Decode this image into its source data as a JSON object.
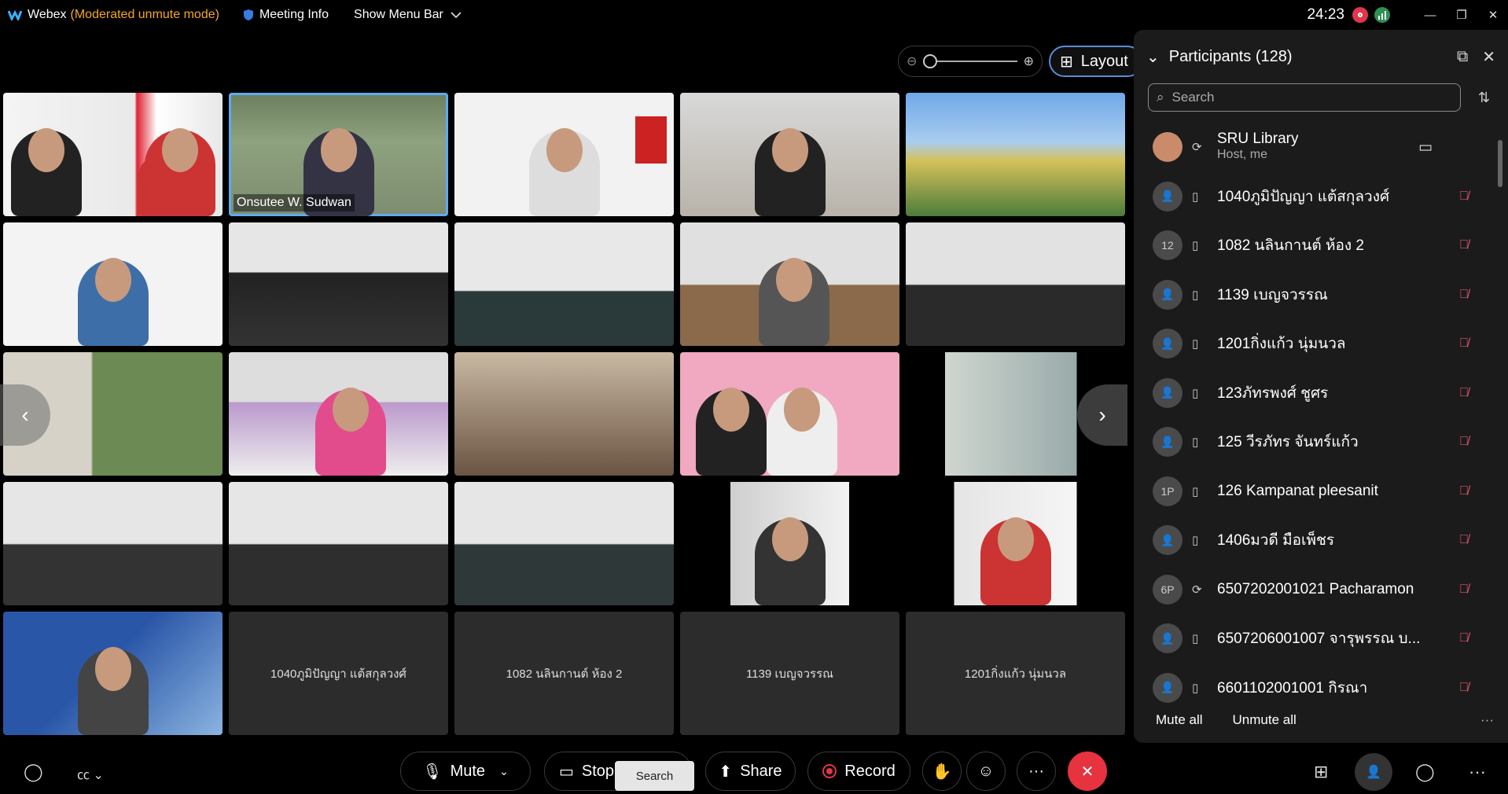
{
  "titlebar": {
    "app_name": "Webex",
    "mode": "(Moderated unmute mode)",
    "meeting_info": "Meeting Info",
    "show_menu": "Show Menu Bar",
    "clock": "24:23"
  },
  "layout_button": "Layout",
  "grid": {
    "active_name": "Onsutee W. Sudwan",
    "name_tiles": [
      "1040ภูมิปัญญา แต้สกุลวงศ์",
      "1082 นลินกานต์ ห้อง 2",
      "1139 เบญจวรรณ",
      "1201กิ่งแก้ว นุ่มนวล"
    ]
  },
  "participants": {
    "title": "Participants (128)",
    "search_placeholder": "Search",
    "host": {
      "name": "SRU Library",
      "role": "Host, me"
    },
    "list": [
      {
        "avatar": "",
        "name": "1040ภูมิปัญญา แต้สกุลวงศ์",
        "device": "phone"
      },
      {
        "avatar": "12",
        "name": "1082 นลินกานต์ ห้อง 2",
        "device": "phone"
      },
      {
        "avatar": "",
        "name": "1139 เบญจวรรณ",
        "device": "phone"
      },
      {
        "avatar": "",
        "name": "1201กิ่งแก้ว นุ่มนวล",
        "device": "phone"
      },
      {
        "avatar": "",
        "name": "123ภัทรพงศ์ ชูศร",
        "device": "phone"
      },
      {
        "avatar": "",
        "name": "125 วีรภัทร จันทร์แก้ว",
        "device": "phone"
      },
      {
        "avatar": "1P",
        "name": "126 Kampanat pleesanit",
        "device": "phone"
      },
      {
        "avatar": "",
        "name": "1406มวดี มือเพ็ชร",
        "device": "phone"
      },
      {
        "avatar": "6P",
        "name": "6507202001021 Pacharamon",
        "device": "sync"
      },
      {
        "avatar": "",
        "name": "6507206001007 จารุพรรณ บ...",
        "device": "phone"
      },
      {
        "avatar": "",
        "name": "6601102001001 กิรณา",
        "device": "phone"
      }
    ],
    "mute_all": "Mute all",
    "unmute_all": "Unmute all"
  },
  "controls": {
    "mute": "Mute",
    "stop_video": "Stop",
    "tooltip": "Search",
    "share": "Share",
    "record": "Record"
  },
  "colors": {
    "mode": "#f5a623",
    "end_call": "#e6333f",
    "active_border": "#5fa9f2",
    "muted_icon": "#e0566b"
  }
}
